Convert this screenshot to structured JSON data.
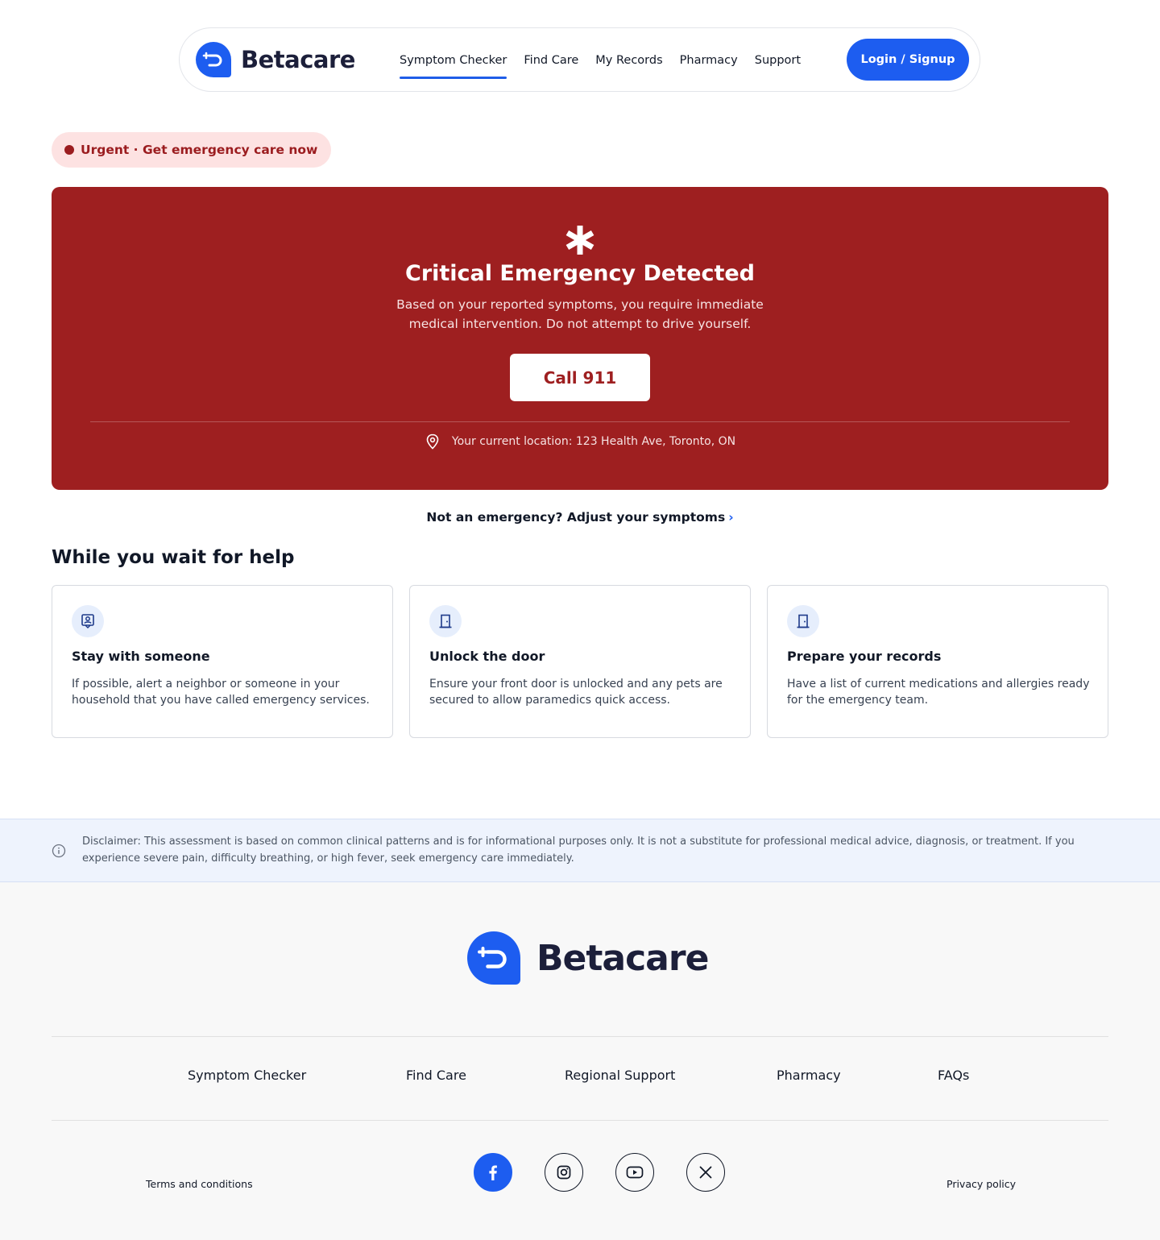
{
  "header": {
    "brand": "Betacare",
    "nav": [
      {
        "label": "Symptom Checker",
        "active": true
      },
      {
        "label": "Find Care"
      },
      {
        "label": "My Records"
      },
      {
        "label": "Pharmacy"
      },
      {
        "label": "Support"
      }
    ],
    "login_label": "Login / Signup"
  },
  "urgent_badge": "Urgent · Get emergency care now",
  "emergency": {
    "title": "Critical Emergency Detected",
    "description": "Based on your reported symptoms, you require immediate medical intervention. Do not attempt to drive yourself.",
    "call_label": "Call 911",
    "location": "Your current location: 123 Health Ave, Toronto, ON"
  },
  "adjust_link": "Not an emergency? Adjust your symptoms",
  "wait": {
    "title": "While you wait for help",
    "cards": [
      {
        "icon": "person-badge-icon",
        "title": "Stay with someone",
        "text": "If possible, alert a neighbor or someone in your household that you have called emergency services."
      },
      {
        "icon": "door-icon",
        "title": "Unlock the door",
        "text": "Ensure your front door is unlocked and any pets are secured to allow paramedics quick access."
      },
      {
        "icon": "door-icon",
        "title": "Prepare your records",
        "text": "Have a list of current medications and allergies ready for the emergency team."
      }
    ]
  },
  "disclaimer": "Disclaimer: This assessment is based on common clinical patterns and is for informational purposes only. It is not a substitute for professional medical advice, diagnosis, or treatment. If you experience severe pain, difficulty breathing, or high fever, seek emergency care immediately.",
  "footer": {
    "brand": "Betacare",
    "nav": [
      "Symptom Checker",
      "Find Care",
      "Regional Support",
      "Pharmacy",
      "FAQs"
    ],
    "terms": "Terms and conditions",
    "privacy": "Privacy policy",
    "social": [
      "facebook-icon",
      "instagram-icon",
      "youtube-icon",
      "x-icon"
    ]
  },
  "colors": {
    "primary": "#1d5df0",
    "emergency": "#9e1f20",
    "urgent_bg": "#fde2e2",
    "disclaimer_bg": "#eef3fd"
  }
}
